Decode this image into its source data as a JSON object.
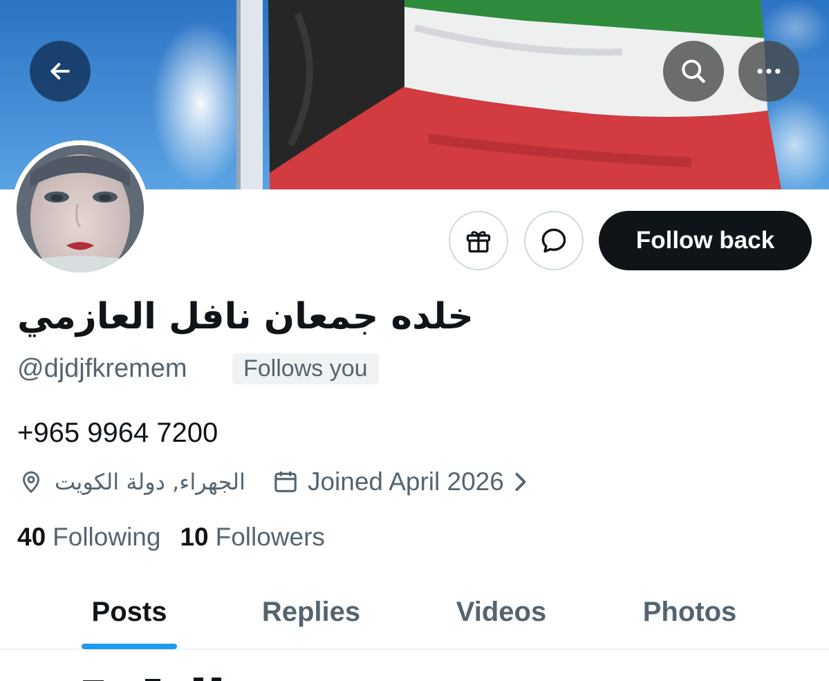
{
  "header": {
    "back_icon": "arrow-left-icon",
    "search_icon": "search-icon",
    "more_icon": "more-horizontal-icon",
    "banner_image": "kuwait-flag-banner"
  },
  "profile": {
    "avatar_image": "profile-photo",
    "display_name": "خلده جمعان نافل العازمي",
    "handle": "@djdjfkremem",
    "follows_you": "Follows you",
    "bio": "+965 9964 7200",
    "location": "الجهراء, دولة الكويت",
    "joined": "Joined April 2026",
    "following_count": "40",
    "following_label": "Following",
    "followers_count": "10",
    "followers_label": "Followers"
  },
  "actions": {
    "gift_icon": "gift-icon",
    "message_icon": "message-icon",
    "follow_back_label": "Follow back"
  },
  "tabs": [
    {
      "label": "Posts",
      "active": true
    },
    {
      "label": "Replies",
      "active": false
    },
    {
      "label": "Videos",
      "active": false
    },
    {
      "label": "Photos",
      "active": false
    }
  ],
  "colors": {
    "accent": "#1d9bf0",
    "text_primary": "#0f1419",
    "text_secondary": "#536471",
    "button_dark": "#0f1419",
    "border": "#cfd9de"
  }
}
